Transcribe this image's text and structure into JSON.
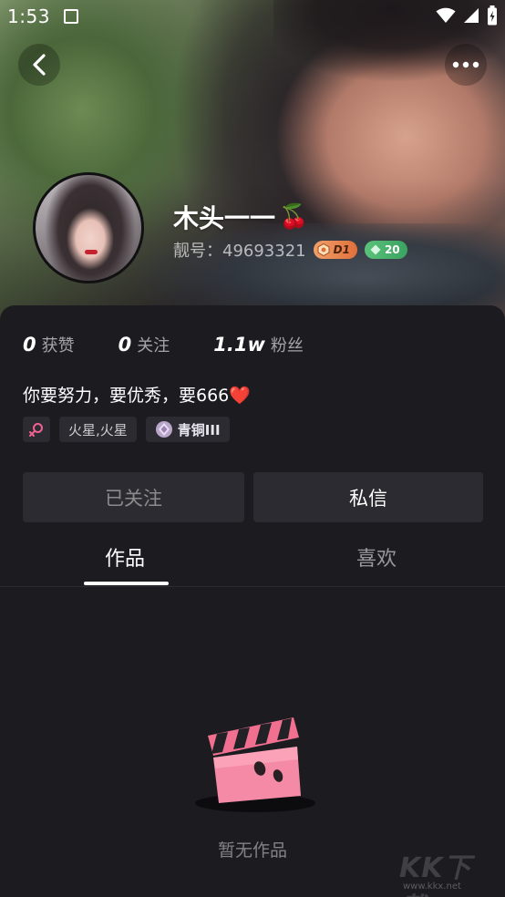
{
  "status_bar": {
    "time": "1:53",
    "icons": [
      "wifi-icon",
      "signal-icon",
      "battery-icon"
    ]
  },
  "nav": {
    "back_icon": "chevron-left-icon",
    "more_icon": "more-horizontal-icon"
  },
  "profile": {
    "nickname": "木头一一",
    "nickname_emoji": "🍒",
    "id_text": "靓号：49693321",
    "level_badge": "D1",
    "gem_badge": "20"
  },
  "stats": [
    {
      "value": "0",
      "label": "获赞"
    },
    {
      "value": "0",
      "label": "关注"
    },
    {
      "value": "1.1w",
      "label": "粉丝"
    }
  ],
  "bio": {
    "text": "你要努力，要优秀，要666",
    "emoji": "❤️"
  },
  "tags": {
    "gender_icon": "female-icon",
    "location": "火星,火星",
    "rank": "青铜III"
  },
  "actions": {
    "followed_label": "已关注",
    "message_label": "私信"
  },
  "tabs": [
    {
      "label": "作品",
      "active": true
    },
    {
      "label": "喜欢",
      "active": false
    }
  ],
  "empty_state": {
    "icon": "clapperboard-icon",
    "text": "暂无作品"
  },
  "watermark": {
    "brand": "KK下载",
    "url": "www.kkx.net"
  },
  "colors": {
    "background": "#1c1b20",
    "button_bg": "#2c2b31",
    "accent_pink": "#f06292",
    "heart_red": "#e53a43"
  }
}
